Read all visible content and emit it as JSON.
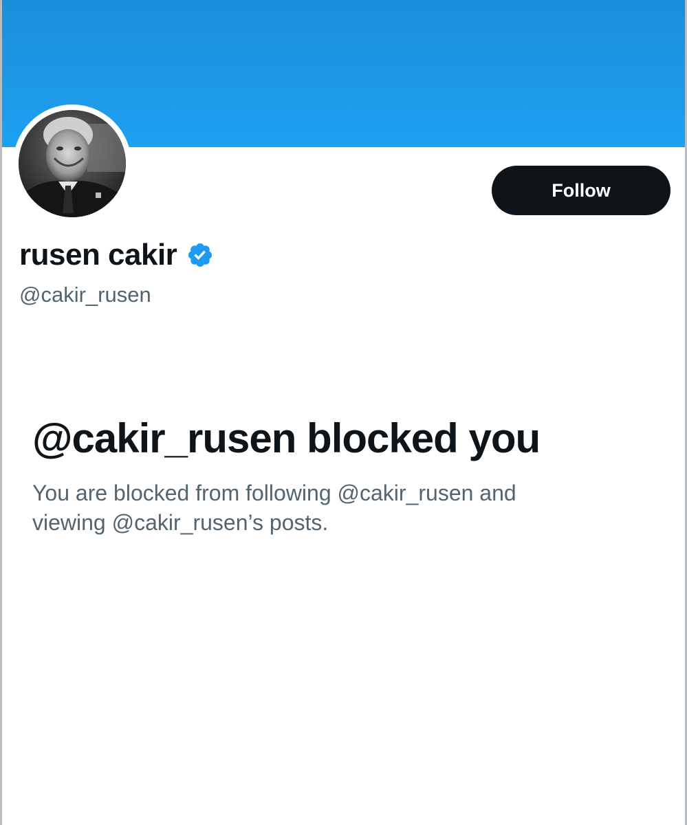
{
  "profile": {
    "display_name": "rusen cakir",
    "handle": "@cakir_rusen",
    "verified": true,
    "avatar_icon": "profile-photo",
    "verified_icon": "verified-badge-icon"
  },
  "actions": {
    "follow_label": "Follow"
  },
  "blocked": {
    "title": "@cakir_rusen blocked you",
    "description_line1": "You are blocked from following @cakir_rusen and",
    "description_line2": "viewing @cakir_rusen’s posts."
  },
  "colors": {
    "banner": "#1da1f2",
    "button_bg": "#0f1419",
    "verified": "#1d9bf0",
    "secondary_text": "#536471"
  }
}
